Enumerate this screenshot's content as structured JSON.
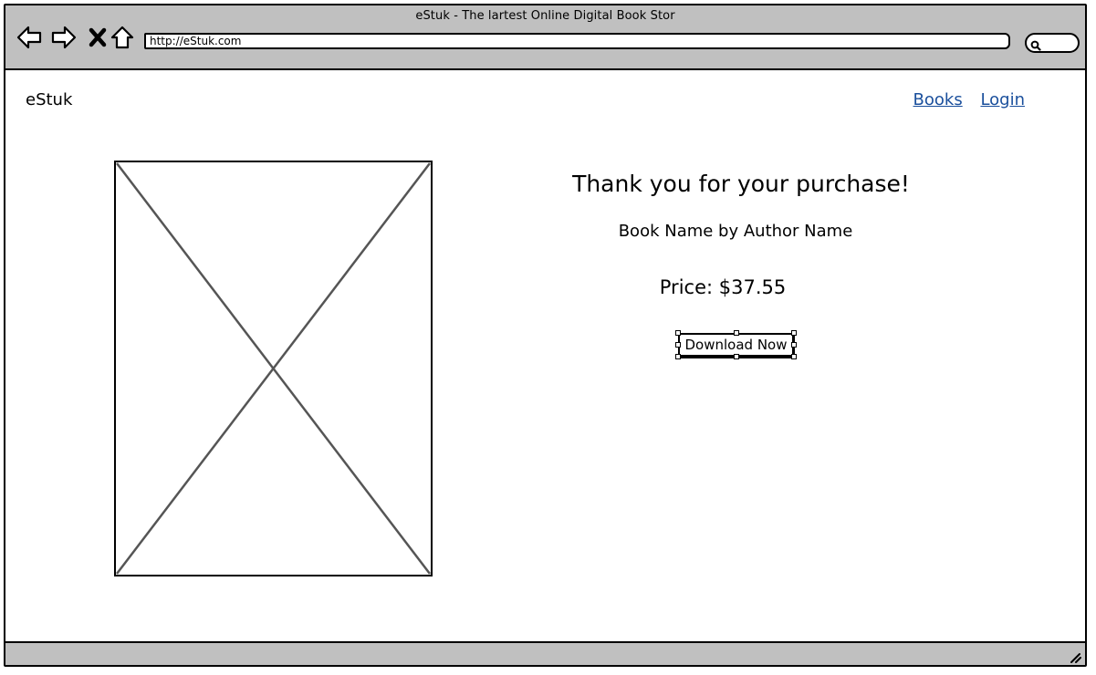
{
  "window": {
    "title": "eStuk - The lartest Online Digital Book Stor"
  },
  "browser": {
    "url": "http://eStuk.com",
    "icons": [
      "back-arrow-icon",
      "forward-arrow-icon",
      "stop-icon",
      "home-icon",
      "search-icon",
      "resize-grip-icon"
    ]
  },
  "header": {
    "logo": "eStuk",
    "nav": {
      "books": "Books",
      "login": "Login"
    }
  },
  "main": {
    "thanks_text": "Thank you for your purchase!",
    "book_line": "Book Name by Author Name",
    "price_text": "Price: $37.55",
    "download_label": "Download Now"
  },
  "colors": {
    "chrome": "#c0c0c0",
    "link": "#1a4f9c"
  }
}
